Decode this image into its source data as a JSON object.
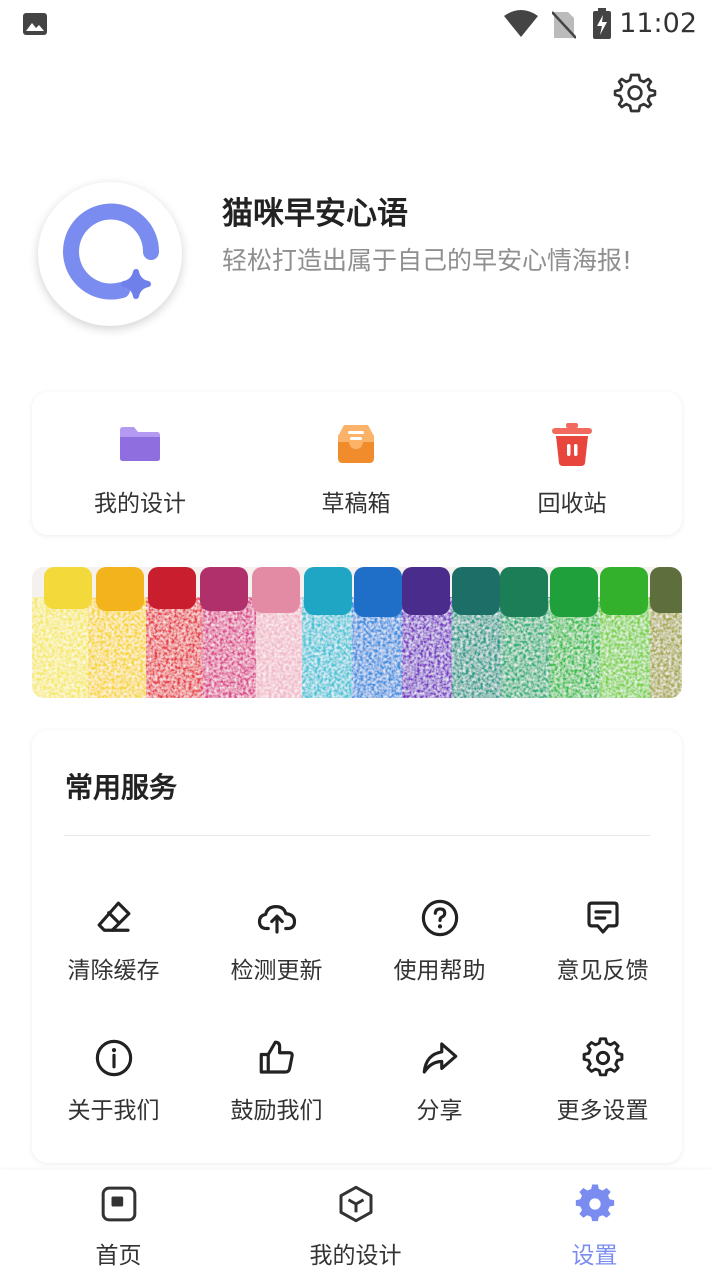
{
  "status_bar": {
    "time": "11:02",
    "icons": [
      "image-icon",
      "wifi-icon",
      "no-sim-icon",
      "battery-charging-icon"
    ]
  },
  "header": {
    "settings_icon": "gear-icon"
  },
  "profile": {
    "app_name": "猫咪早安心语",
    "description": "轻松打造出属于自己的早安心情海报!",
    "avatar_color": "#7b8cf0"
  },
  "quick_actions": [
    {
      "label": "我的设计",
      "icon": "folder-icon",
      "color": "#9b7be8"
    },
    {
      "label": "草稿箱",
      "icon": "inbox-tray-icon",
      "color": "#f5a14a"
    },
    {
      "label": "回收站",
      "icon": "trash-icon",
      "color": "#e8453c"
    }
  ],
  "services": {
    "title": "常用服务",
    "items": [
      {
        "label": "清除缓存",
        "icon": "eraser-icon"
      },
      {
        "label": "检测更新",
        "icon": "cloud-upload-icon"
      },
      {
        "label": "使用帮助",
        "icon": "help-circle-icon"
      },
      {
        "label": "意见反馈",
        "icon": "feedback-icon"
      },
      {
        "label": "关于我们",
        "icon": "info-icon"
      },
      {
        "label": "鼓励我们",
        "icon": "thumbs-up-icon"
      },
      {
        "label": "分享",
        "icon": "share-icon"
      },
      {
        "label": "更多设置",
        "icon": "gear-icon"
      }
    ]
  },
  "bottom_nav": {
    "items": [
      {
        "label": "首页",
        "icon": "home-square-icon"
      },
      {
        "label": "我的设计",
        "icon": "cube-icon"
      },
      {
        "label": "设置",
        "icon": "gear-filled-icon"
      }
    ],
    "active_index": 2,
    "active_color": "#7b8cf0"
  }
}
